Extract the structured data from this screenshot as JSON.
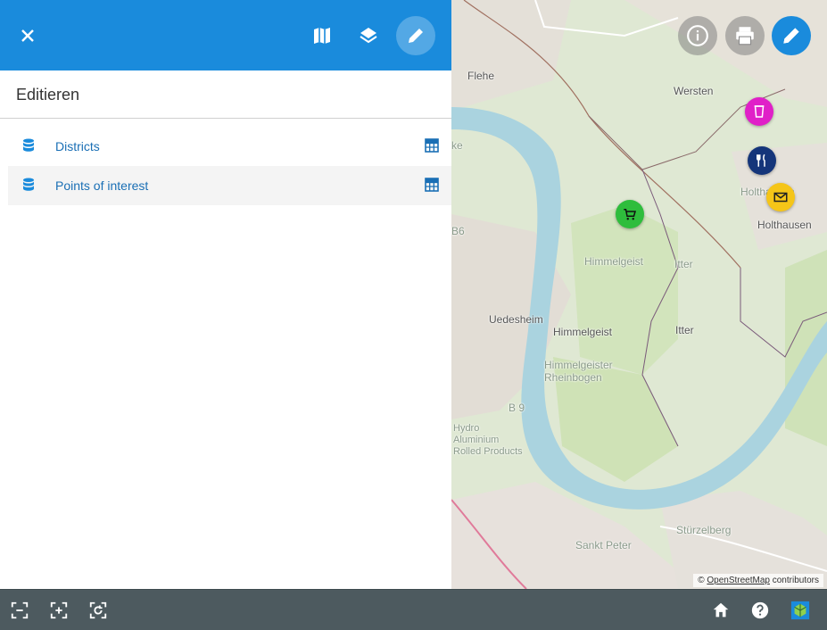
{
  "panel": {
    "title": "Editieren",
    "layers": [
      {
        "label": "Districts",
        "icon": "database-icon",
        "action_icon": "table-icon"
      },
      {
        "label": "Points of interest",
        "icon": "database-icon",
        "action_icon": "table-icon"
      }
    ]
  },
  "header_buttons": [
    "close-icon",
    "map-icon",
    "layers-icon",
    "pencil-icon"
  ],
  "map": {
    "labels": [
      "Flehe",
      "Wersten",
      "Holthausen",
      "Himmelgeist",
      "Itter",
      "Uedesheim",
      "Himmelgeist",
      "Itter",
      "Himmelgeister Rheinbogen",
      "B 9",
      "Sankt Peter",
      "Stürzelberg",
      "Hydro Aluminium Rolled Products",
      "Holthausen",
      "B6",
      "ke"
    ],
    "markers": [
      "trash-icon",
      "restaurant-icon",
      "mail-icon",
      "shopping-cart-icon"
    ],
    "attribution": {
      "prefix": "©",
      "link": "OpenStreetMap",
      "suffix": "contributors"
    }
  },
  "map_buttons": [
    "info-icon",
    "print-icon",
    "edit-icon"
  ],
  "bottom_bar": {
    "left": [
      "zoom-extent-icon",
      "zoom-in-area-icon",
      "zoom-refresh-icon"
    ],
    "right": [
      "home-icon",
      "help-icon",
      "app-logo"
    ]
  },
  "colors": {
    "primary": "#1a8bdc",
    "bottom_bar": "#4d5a5f",
    "link": "#1a6fb5",
    "marker_trash": "#e020c8",
    "marker_restaurant": "#15357a",
    "marker_mail": "#f5c518",
    "marker_cart": "#2ebd3c"
  }
}
